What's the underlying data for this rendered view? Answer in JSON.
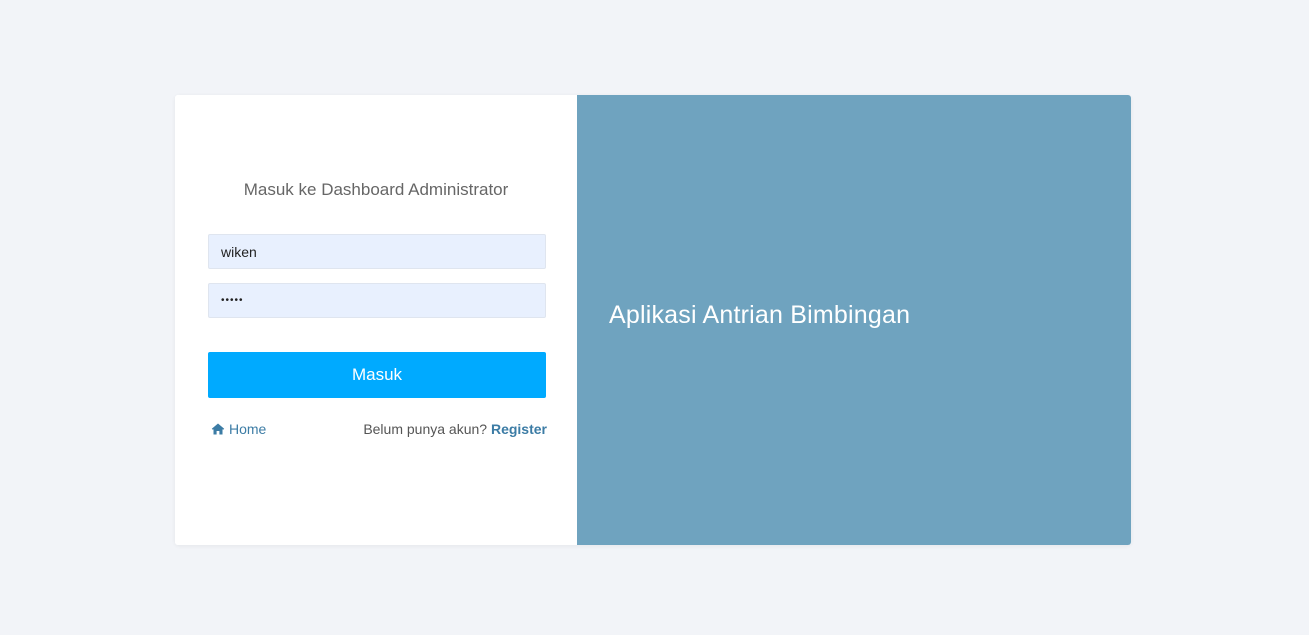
{
  "form": {
    "title": "Masuk ke Dashboard Administrator",
    "username_value": "wiken",
    "password_value": "•••••",
    "submit_label": "Masuk"
  },
  "footer": {
    "home_label": "Home",
    "home_icon": "home-icon",
    "register_prompt": "Belum punya akun?",
    "register_label": "Register"
  },
  "panel": {
    "app_title": "Aplikasi Antrian Bimbingan",
    "background_color": "#6fa3bf"
  },
  "colors": {
    "page_background": "#f2f4f8",
    "button": "#00aaff",
    "link": "#3c7ca5",
    "input_background": "#e8f0fe"
  }
}
